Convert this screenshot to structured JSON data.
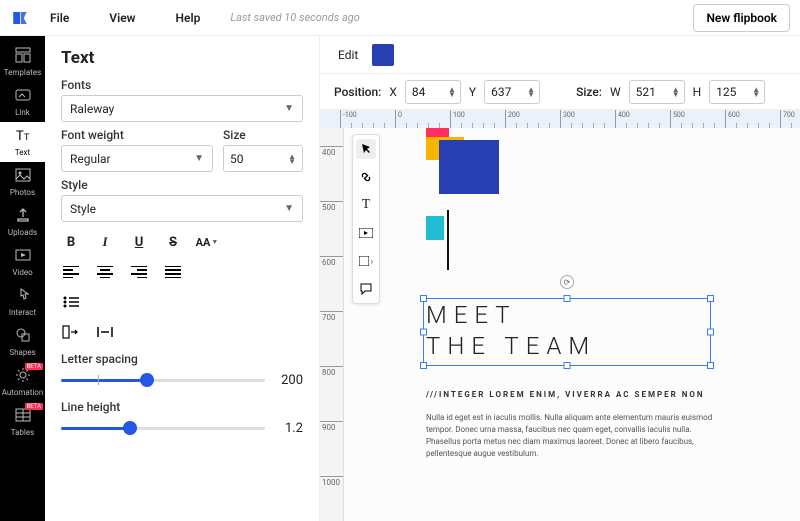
{
  "top": {
    "file": "File",
    "view": "View",
    "help": "Help",
    "status": "Last saved 10 seconds ago",
    "newbtn": "New flipbook"
  },
  "rail": [
    {
      "id": "templates",
      "label": "Templates"
    },
    {
      "id": "link",
      "label": "Link"
    },
    {
      "id": "text",
      "label": "Text"
    },
    {
      "id": "photos",
      "label": "Photos"
    },
    {
      "id": "uploads",
      "label": "Uploads"
    },
    {
      "id": "video",
      "label": "Video"
    },
    {
      "id": "interact",
      "label": "Interact"
    },
    {
      "id": "shapes",
      "label": "Shapes"
    },
    {
      "id": "automation",
      "label": "Automation",
      "beta": true
    },
    {
      "id": "tables",
      "label": "Tables",
      "beta": true
    }
  ],
  "panel": {
    "title": "Text",
    "fonts_label": "Fonts",
    "fonts_value": "Raleway",
    "weight_label": "Font weight",
    "weight_value": "Regular",
    "size_label": "Size",
    "size_value": "50",
    "style_label": "Style",
    "style_value": "Style",
    "aa": "AA",
    "letter_label": "Letter spacing",
    "letter_value": "200",
    "lh_label": "Line height",
    "lh_value": "1.2"
  },
  "editbar": {
    "edit": "Edit"
  },
  "posbar": {
    "position": "Position:",
    "x": "X",
    "xv": "84",
    "y": "Y",
    "yv": "637",
    "size": "Size:",
    "w": "W",
    "wv": "521",
    "h": "H",
    "hv": "125"
  },
  "canvas": {
    "headline1": "MEET",
    "headline2": "THE TEAM",
    "subhead": "///INTEGER LOREM ENIM, VIVERRA AC SEMPER NON",
    "body": "Nulla id eget est in iaculis mollis. Nulla aliquam ante elementum mauris euismod tempor. Donec urna massa, faucibus nec quam eget, convallis iaculis nulla. Phasellus porta metus nec diam maximus laoreet. Donec at libero faucibus, pellentesque augue vestibulum."
  },
  "ruler_h": [
    -100,
    0,
    100,
    200,
    300,
    400,
    500,
    600,
    700
  ],
  "ruler_v": [
    400,
    500,
    600,
    700,
    800,
    900,
    1000
  ]
}
